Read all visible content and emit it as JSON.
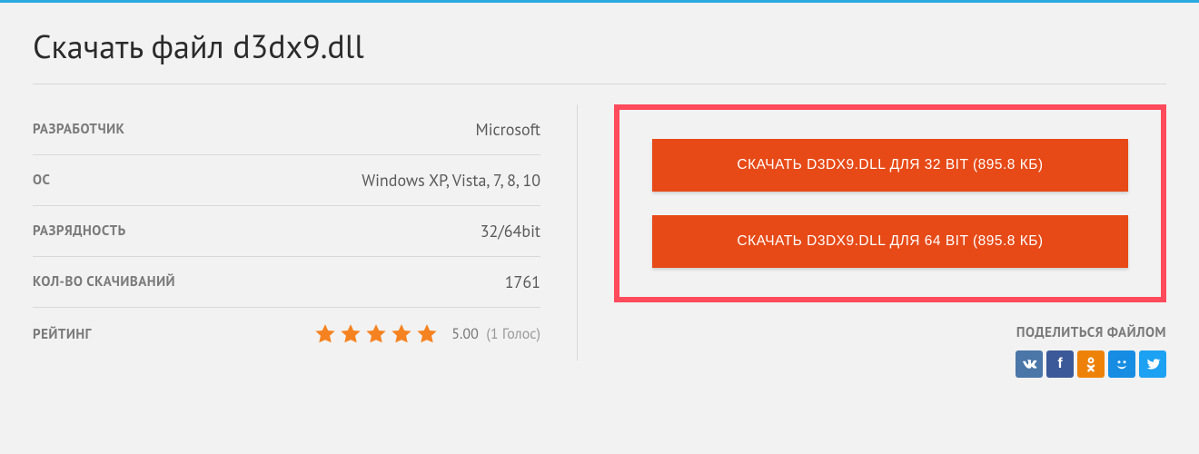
{
  "page_title": "Скачать файл d3dx9.dll",
  "info": {
    "rows": [
      {
        "label": "РАЗРАБОТЧИК",
        "value": "Microsoft"
      },
      {
        "label": "ОС",
        "value": "Windows XP, Vista, 7, 8, 10"
      },
      {
        "label": "РАЗРЯДНОСТЬ",
        "value": "32/64bit"
      },
      {
        "label": "КОЛ-ВО СКАЧИВАНИЙ",
        "value": "1761"
      }
    ],
    "rating_label": "РЕЙТИНГ",
    "rating_score": "5.00",
    "rating_votes": "(1 Голос)",
    "stars_filled": 5
  },
  "downloads": {
    "btn32": "СКАЧАТЬ D3DX9.DLL ДЛЯ 32 BIT (895.8 КБ)",
    "btn64": "СКАЧАТЬ D3DX9.DLL ДЛЯ 64 BIT (895.8 КБ)"
  },
  "share": {
    "title": "ПОДЕЛИТЬСЯ ФАЙЛОМ",
    "networks": [
      "vk",
      "fb",
      "ok",
      "mo",
      "tw"
    ]
  },
  "colors": {
    "accent_border": "#ff4b5c",
    "button": "#e74a17",
    "star": "#f58220",
    "top_bar": "#2aa9e0"
  }
}
